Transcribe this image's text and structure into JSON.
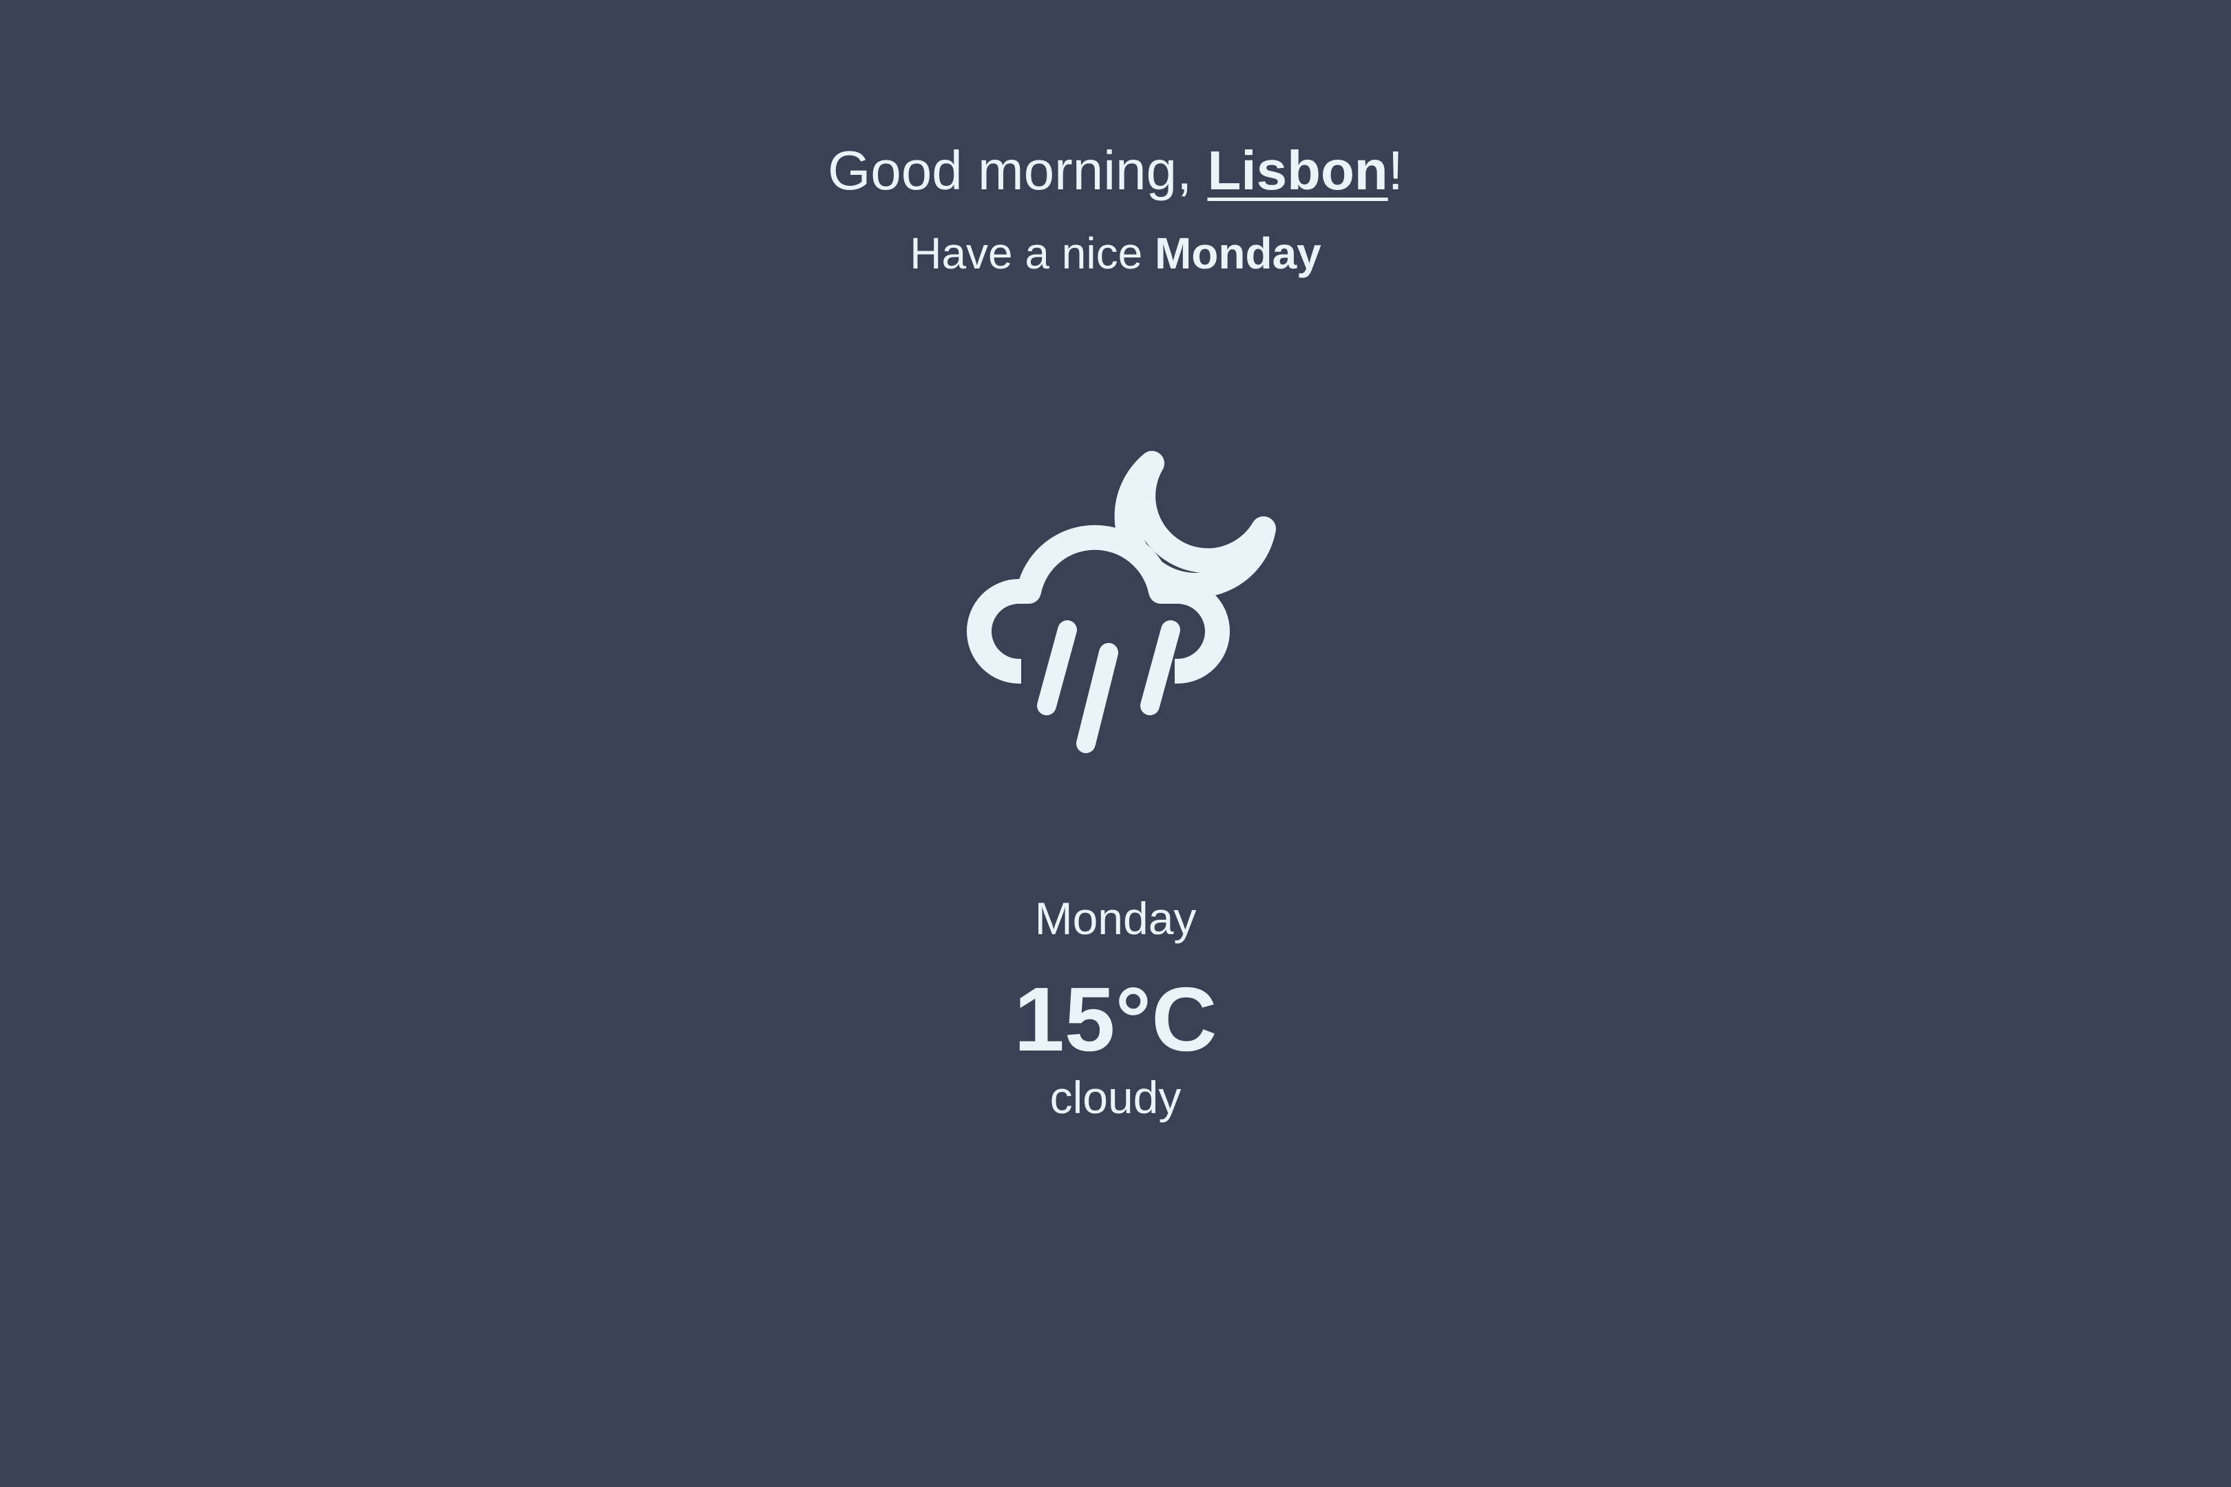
{
  "greeting": {
    "prefix": "Good morning, ",
    "city": "Lisbon",
    "suffix": "!"
  },
  "subgreeting": {
    "prefix": "Have a nice ",
    "day": "Monday"
  },
  "forecast": {
    "icon": "night-rain-cloud-icon",
    "day": "Monday",
    "temperature": "15°C",
    "condition": "cloudy"
  },
  "colors": {
    "background": "#3b4154",
    "foreground": "#e9f4f8"
  }
}
